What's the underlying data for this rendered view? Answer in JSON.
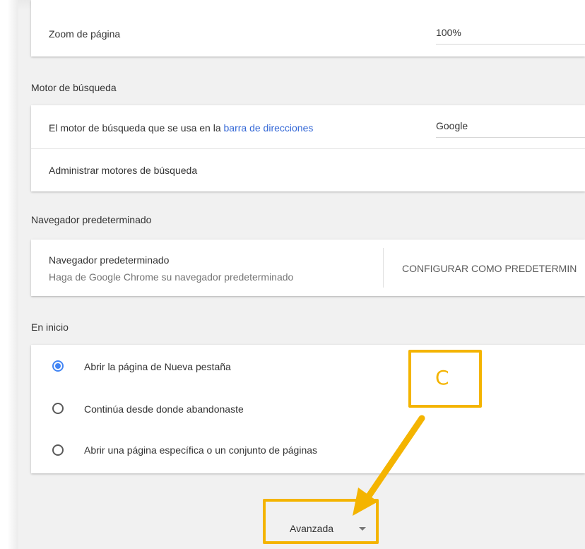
{
  "zoom": {
    "label": "Zoom de página",
    "value": "100%"
  },
  "search_engine": {
    "section_title": "Motor de búsqueda",
    "row_prefix": "El motor de búsqueda que se usa en la ",
    "row_link": "barra de direcciones",
    "selected": "Google",
    "manage_label": "Administrar motores de búsqueda"
  },
  "default_browser": {
    "section_title": "Navegador predeterminado",
    "title": "Navegador predeterminado",
    "subtitle": "Haga de Google Chrome su navegador predeterminado",
    "button_label": "CONFIGURAR COMO PREDETERMIN"
  },
  "on_startup": {
    "section_title": "En inicio",
    "options": [
      {
        "label": "Abrir la página de Nueva pestaña",
        "checked": true
      },
      {
        "label": "Continúa desde donde abandonaste",
        "checked": false
      },
      {
        "label": "Abrir una página específica o un conjunto de páginas",
        "checked": false
      }
    ]
  },
  "advanced": {
    "label": "Avanzada",
    "icon": "caret-down-icon"
  },
  "annotation": {
    "letter": "C",
    "color": "#f4b400"
  },
  "colors": {
    "link": "#3367d6",
    "radio_selected": "#4285f4"
  }
}
